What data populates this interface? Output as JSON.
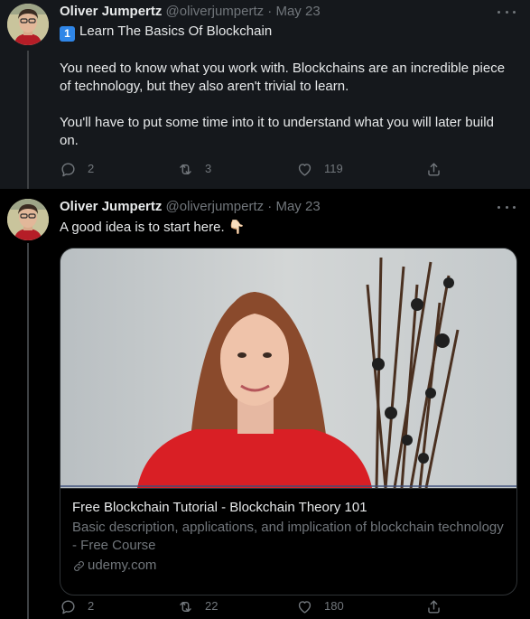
{
  "tweets": [
    {
      "author_name": "Oliver Jumpertz",
      "handle_date": "@oliverjumpertz · May 23",
      "keycap": "1",
      "lines": [
        "Learn The Basics Of Blockchain",
        "You need to know what you work with. Blockchains are an incredible piece of technology, but they also aren't trivial to learn.",
        "You'll have to put some time into it to understand what you will later build on."
      ],
      "replies": "2",
      "retweets": "3",
      "likes": "119"
    },
    {
      "author_name": "Oliver Jumpertz",
      "handle_date": "@oliverjumpertz · May 23",
      "text": "A good idea is to start here. 👇🏻",
      "card": {
        "title": "Free Blockchain Tutorial - Blockchain Theory 101",
        "description": "Basic description, applications, and implication of blockchain technology - Free Course",
        "domain": "udemy.com"
      },
      "replies": "2",
      "retweets": "22",
      "likes": "180"
    }
  ],
  "colors": {
    "background": "#000000",
    "highlight_background": "#15181c",
    "text_primary": "#e7e9ea",
    "text_secondary": "#71767b",
    "keycap_blue": "#2f86e8"
  },
  "icons": [
    "more-icon",
    "reply-icon",
    "retweet-icon",
    "like-icon",
    "share-icon",
    "link-icon",
    "keycap-one-icon",
    "pointing-down-emoji"
  ]
}
